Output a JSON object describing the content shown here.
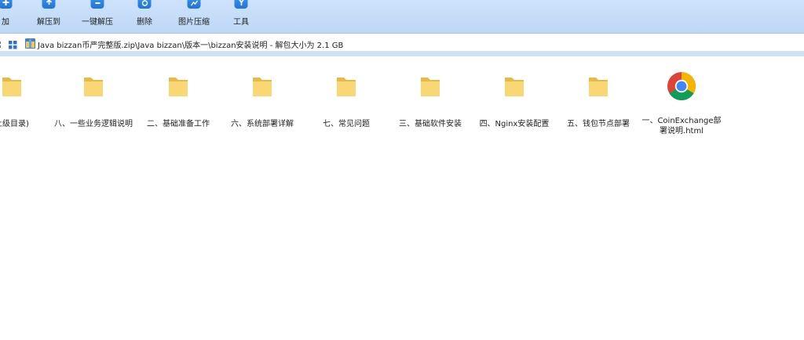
{
  "toolbar": {
    "items": [
      {
        "label": "加",
        "icon": "add-icon"
      },
      {
        "label": "解压到",
        "icon": "extract-to-icon"
      },
      {
        "label": "一键解压",
        "icon": "quick-extract-icon"
      },
      {
        "label": "删除",
        "icon": "delete-icon"
      },
      {
        "label": "图片压缩",
        "icon": "image-compress-icon"
      },
      {
        "label": "工具",
        "icon": "tools-icon"
      }
    ]
  },
  "address": {
    "path": "Java bizzan币严完整版.zip\\Java bizzan\\版本一\\bizzan安装说明 - 解包大小为 2.1 GB"
  },
  "files": [
    {
      "label": "上级目录)",
      "icon": "folder-icon"
    },
    {
      "label": "八、一些业务逻辑说明",
      "icon": "folder-icon"
    },
    {
      "label": "二、基础准备工作",
      "icon": "folder-icon"
    },
    {
      "label": "六、系统部署详解",
      "icon": "folder-icon"
    },
    {
      "label": "七、常见问题",
      "icon": "folder-icon"
    },
    {
      "label": "三、基础软件安装",
      "icon": "folder-icon"
    },
    {
      "label": "四、Nginx安装配置",
      "icon": "folder-icon"
    },
    {
      "label": "五、钱包节点部署",
      "icon": "folder-icon"
    },
    {
      "label": "一、CoinExchange部署说明.html",
      "icon": "chrome-icon"
    }
  ],
  "colors": {
    "toolbar_bg": "#c6ddf8",
    "accent": "#1f74d8",
    "folder": "#f7d66b"
  }
}
